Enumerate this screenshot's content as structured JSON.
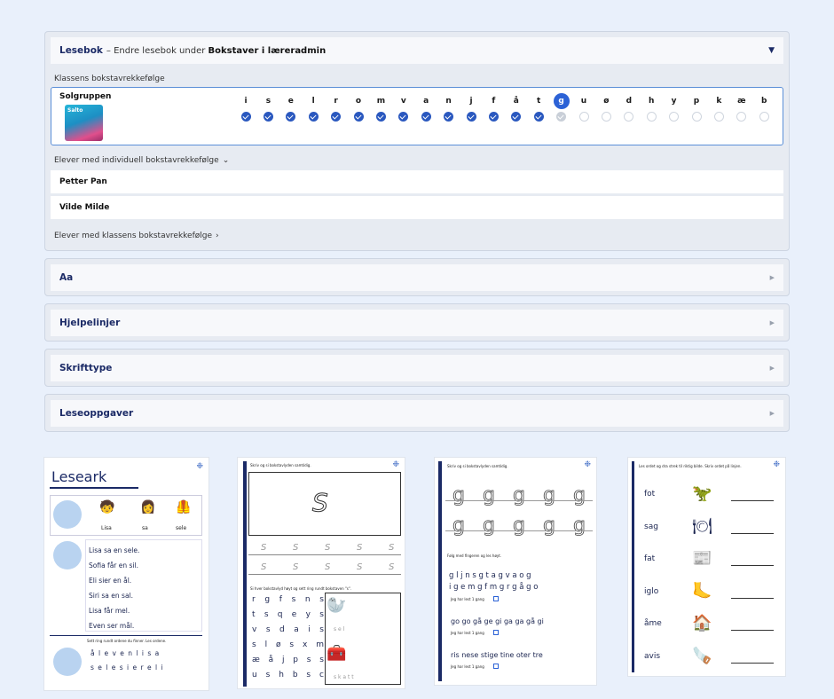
{
  "main_panel": {
    "title": "Lesebok",
    "subtitle_prefix": "– Endre lesebok under",
    "subtitle_bold": "Bokstaver i læreradmin",
    "section_label": "Klassens bokstavrekkefølge",
    "group_name": "Solgruppen",
    "book_cover_text": "Salto",
    "letters": [
      "i",
      "s",
      "e",
      "l",
      "r",
      "o",
      "m",
      "v",
      "a",
      "n",
      "j",
      "f",
      "å",
      "t",
      "g",
      "u",
      "ø",
      "d",
      "h",
      "y",
      "p",
      "k",
      "æ",
      "b"
    ],
    "current_letter_index": 14,
    "learned_count": 14,
    "individual_label": "Elever med individuell bokstavrekkefølge",
    "students": [
      "Petter Pan",
      "Vilde Milde"
    ],
    "class_order_label": "Elever med klassens bokstavrekkefølge"
  },
  "collapsed_panels": [
    {
      "title": "Aa"
    },
    {
      "title": "Hjelpelinjer"
    },
    {
      "title": "Skrifttype"
    },
    {
      "title": "Leseoppgaver"
    }
  ],
  "sheet1": {
    "title": "Leseark",
    "words": [
      "Lisa",
      "sa",
      "sele"
    ],
    "sentences": [
      "Lisa sa en sele.",
      "Sofia får en sil.",
      "Eli sier en ål.",
      "Siri sa en sal.",
      "Lisa får mel.",
      "Even ser mål."
    ],
    "instruction": "Sett ring rundt ordene du finner. Les ordene.",
    "puzzle_line1": "å l e v e n l i s a",
    "puzzle_line2": "s e l e s i e r e l i"
  },
  "sheet2": {
    "instruction1": "Skriv og si bokstavlyden samtidig.",
    "big_letter": "S",
    "trace_letter": "S",
    "instruction2": "Si hver bokstavlyd høyt og sett ring rundt bokstaven \"s\".",
    "grid": [
      [
        "r",
        "g",
        "f",
        "s",
        "n",
        "s"
      ],
      [
        "t",
        "s",
        "q",
        "e",
        "y",
        "s"
      ],
      [
        "v",
        "s",
        "d",
        "a",
        "i",
        "s"
      ],
      [
        "s",
        "l",
        "ø",
        "s",
        "x",
        "m"
      ],
      [
        "æ",
        "å",
        "j",
        "p",
        "s",
        "s"
      ],
      [
        "u",
        "s",
        "h",
        "b",
        "s",
        "c"
      ]
    ],
    "trace_word1": "s e l",
    "trace_word2": "s k a t t"
  },
  "sheet3": {
    "instruction1": "Skriv og si bokstavlyden samtidig.",
    "trace_letter": "g",
    "instruction2": "Følg med fingeren og les høyt.",
    "line1": "g l j n s g t a g v a o g",
    "line2": "i g e m g f m g r g å g o",
    "read_label": "Jeg har lest 1 gang",
    "line3": "go go gå ge gi ga ga gå gi",
    "line4": "ris nese stige tine oter tre"
  },
  "sheet4": {
    "instruction": "Les ordet og dra strek til riktig bilde. Skriv ordet på linjen.",
    "words": [
      "fot",
      "sag",
      "fat",
      "iglo",
      "åme",
      "avis"
    ]
  },
  "colors": {
    "accent": "#2c62d6",
    "navy": "#1b2a66",
    "background": "#e9f0fb"
  }
}
